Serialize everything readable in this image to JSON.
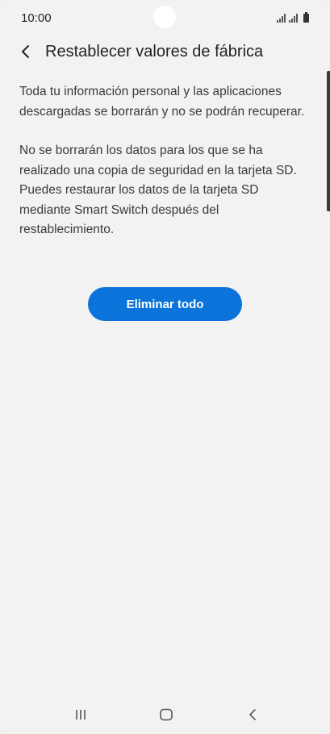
{
  "status_bar": {
    "time": "10:00"
  },
  "header": {
    "title": "Restablecer valores de fábrica",
    "back_icon": "chevron-left-icon"
  },
  "content": {
    "paragraph_1": "Toda tu información personal y las aplicaciones descargadas se borrarán y no se podrán recuperar.",
    "paragraph_2": "No se borrarán los datos para los que se ha realizado una copia de seguridad en la tarjeta SD. Puedes restaurar los datos de la tarjeta SD mediante Smart Switch después del restablecimiento."
  },
  "actions": {
    "delete_all_label": "Eliminar todo"
  },
  "nav_bar": {
    "recents_icon": "recents-icon",
    "home_icon": "home-icon",
    "back_icon": "back-icon"
  },
  "colors": {
    "primary": "#0b73d9",
    "background": "#f2f2f2",
    "text": "#3a3a3a"
  }
}
